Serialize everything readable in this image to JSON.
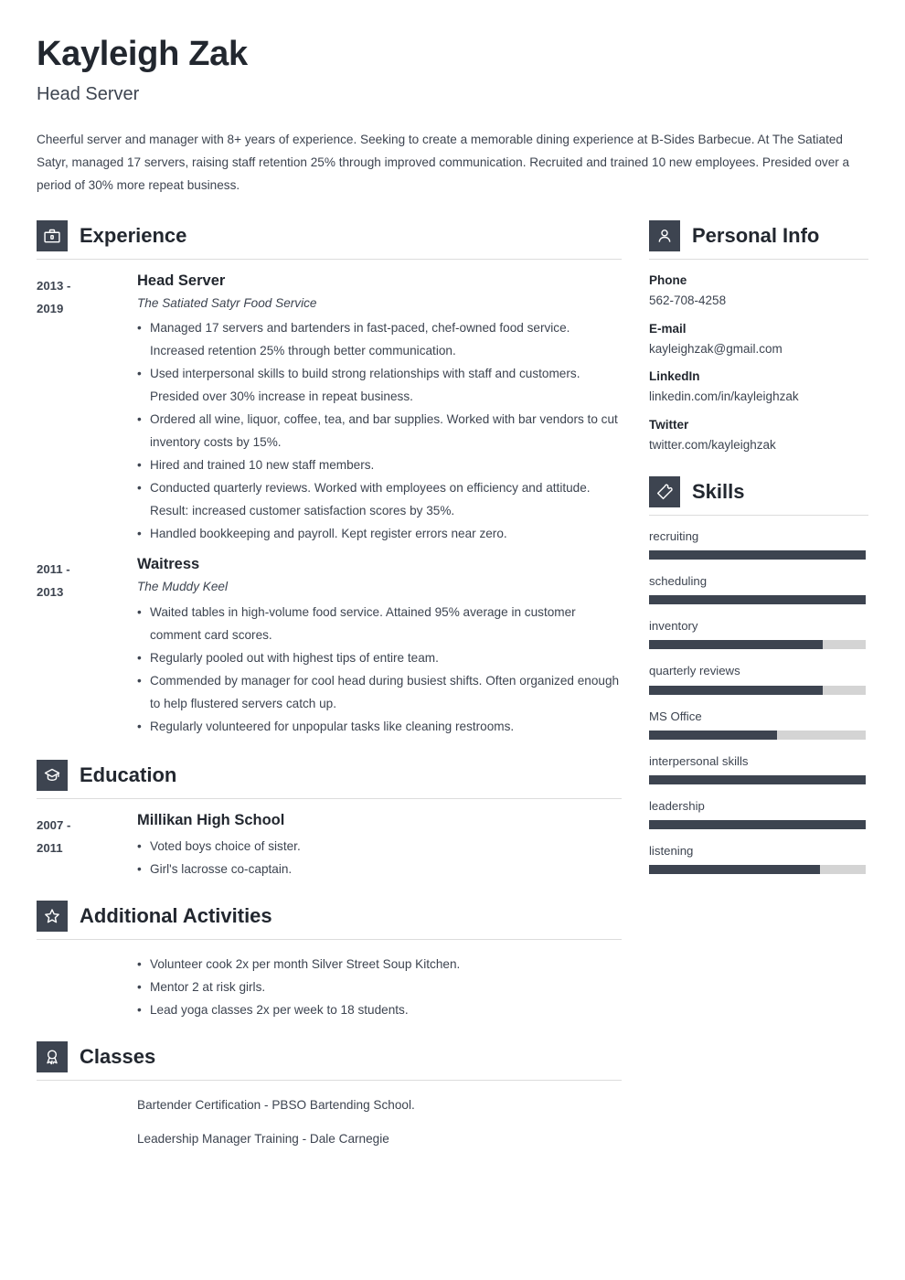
{
  "header": {
    "name": "Kayleigh Zak",
    "job_title": "Head Server",
    "summary": "Cheerful server and manager with 8+ years of experience. Seeking to create a memorable dining experience at B-Sides Barbecue. At The Satiated Satyr, managed 17 servers, raising staff retention 25% through improved communication. Recruited and trained 10 new employees. Presided over a period of 30% more repeat business."
  },
  "colors": {
    "accent": "#3d4450",
    "heading": "#22272f",
    "rule": "#dcdcdc",
    "track": "#d4d4d4"
  },
  "sections": {
    "experience": {
      "title": "Experience",
      "icon": "briefcase-icon",
      "entries": [
        {
          "date": "2013 - 2019",
          "date_line1": "2013 -",
          "date_line2": "2019",
          "role": "Head Server",
          "org": "The Satiated Satyr Food Service",
          "bullets": [
            "Managed 17 servers and bartenders in fast-paced, chef-owned food service. Increased retention 25% through better communication.",
            "Used interpersonal skills to build strong relationships with staff and customers. Presided over 30% increase in repeat business.",
            "Ordered all wine, liquor, coffee, tea, and bar supplies. Worked with bar vendors to cut inventory costs by 15%.",
            "Hired and trained 10 new staff members.",
            "Conducted quarterly reviews. Worked with employees on efficiency and attitude. Result: increased customer satisfaction scores by 35%.",
            "Handled bookkeeping and payroll. Kept register errors near zero."
          ]
        },
        {
          "date": "2011 - 2013",
          "date_line1": "2011 -",
          "date_line2": "2013",
          "role": "Waitress",
          "org": "The Muddy Keel",
          "bullets": [
            "Waited tables in high-volume food service. Attained 95% average in customer comment card scores.",
            "Regularly pooled out with highest tips of entire team.",
            "Commended by manager for cool head during busiest shifts. Often organized enough to help flustered servers catch up.",
            "Regularly volunteered for unpopular tasks like cleaning restrooms."
          ]
        }
      ]
    },
    "education": {
      "title": "Education",
      "icon": "graduation-cap-icon",
      "entries": [
        {
          "date_line1": "2007 -",
          "date_line2": "2011",
          "role": "Millikan High School",
          "bullets": [
            "Voted boys choice of sister.",
            "Girl's lacrosse co-captain."
          ]
        }
      ]
    },
    "additional_activities": {
      "title": "Additional Activities",
      "icon": "star-icon",
      "bullets": [
        "Volunteer cook 2x per month Silver Street Soup Kitchen.",
        "Mentor 2 at risk girls.",
        "Lead yoga classes 2x per week to 18 students."
      ]
    },
    "classes": {
      "title": "Classes",
      "icon": "award-ribbon-icon",
      "lines": [
        "Bartender Certification - PBSO Bartending School.",
        "Leadership Manager Training - Dale Carnegie"
      ]
    },
    "personal_info": {
      "title": "Personal Info",
      "icon": "person-icon",
      "fields": [
        {
          "label": "Phone",
          "value": "562-708-4258"
        },
        {
          "label": "E-mail",
          "value": "kayleighzak@gmail.com"
        },
        {
          "label": "LinkedIn",
          "value": "linkedin.com/in/kayleighzak"
        },
        {
          "label": "Twitter",
          "value": "twitter.com/kayleighzak"
        }
      ]
    },
    "skills": {
      "title": "Skills",
      "icon": "puzzle-piece-icon",
      "items": [
        {
          "name": "recruiting",
          "level": 100
        },
        {
          "name": "scheduling",
          "level": 100
        },
        {
          "name": "inventory",
          "level": 80
        },
        {
          "name": "quarterly reviews",
          "level": 80
        },
        {
          "name": "MS Office",
          "level": 59
        },
        {
          "name": "interpersonal skills",
          "level": 100
        },
        {
          "name": "leadership",
          "level": 100
        },
        {
          "name": "listening",
          "level": 79
        }
      ]
    }
  }
}
